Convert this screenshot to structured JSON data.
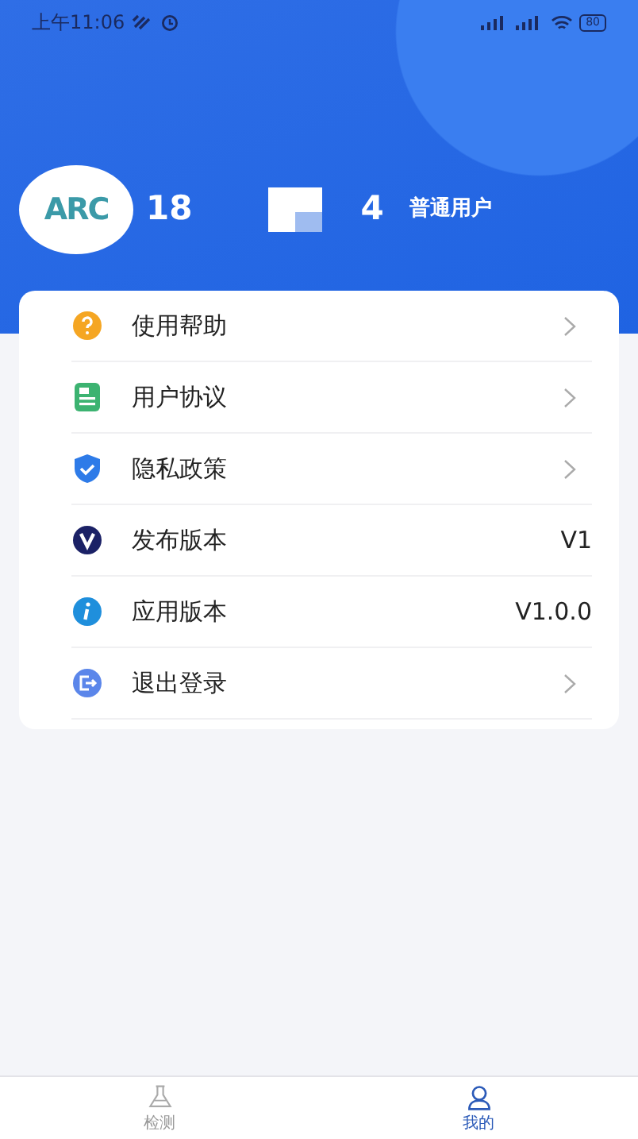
{
  "status_bar": {
    "time": "上午11:06",
    "battery": "80"
  },
  "profile": {
    "logo": "ARC",
    "phone_start": "18",
    "phone_end": "4",
    "role": "普通用户"
  },
  "menu": [
    {
      "label": "使用帮助",
      "kind": "link"
    },
    {
      "label": "用户协议",
      "kind": "link"
    },
    {
      "label": "隐私政策",
      "kind": "link"
    },
    {
      "label": "发布版本",
      "kind": "value",
      "value": "V1"
    },
    {
      "label": "应用版本",
      "kind": "value",
      "value": "V1.0.0"
    },
    {
      "label": "退出登录",
      "kind": "link"
    }
  ],
  "tabs": [
    {
      "label": "检测",
      "selected": false
    },
    {
      "label": "我的",
      "selected": true
    }
  ]
}
